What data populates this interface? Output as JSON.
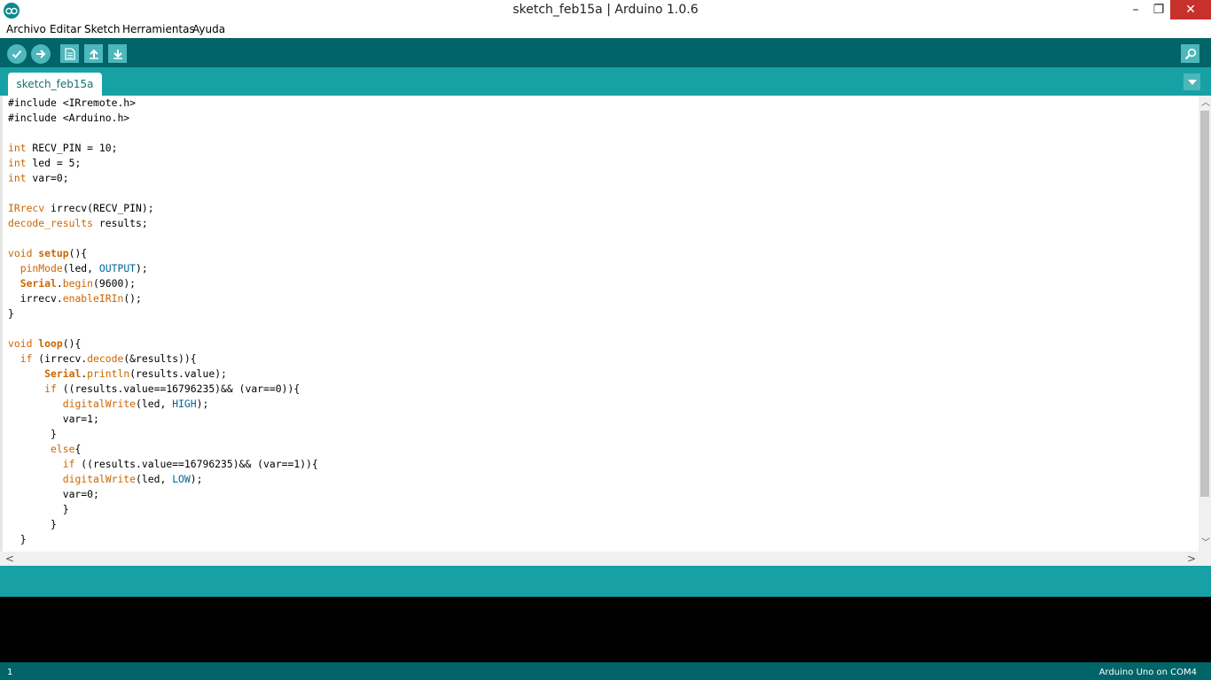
{
  "window": {
    "title": "sketch_feb15a | Arduino 1.0.6",
    "minimize": "–",
    "maximize": "❐",
    "close": "✕"
  },
  "menu": [
    "Archivo",
    "Editar",
    "Sketch",
    "Herramientas",
    "Ayuda"
  ],
  "toolbar": {
    "buttons": [
      "verify-icon",
      "upload-icon",
      "new-icon",
      "open-icon",
      "save-icon",
      "serial-monitor-icon"
    ]
  },
  "tab": {
    "label": "sketch_feb15a"
  },
  "code": {
    "lines": [
      [
        [
          "#include <IRremote.h>",
          "plain"
        ]
      ],
      [
        [
          "#include <Arduino.h>",
          "plain"
        ]
      ],
      [],
      [
        [
          "int",
          "type"
        ],
        [
          " RECV_PIN = 10;",
          "plain"
        ]
      ],
      [
        [
          "int",
          "type"
        ],
        [
          " led = 5;",
          "plain"
        ]
      ],
      [
        [
          "int",
          "type"
        ],
        [
          " var=0;",
          "plain"
        ]
      ],
      [],
      [
        [
          "IRrecv",
          "type"
        ],
        [
          " irrecv(RECV_PIN);",
          "plain"
        ]
      ],
      [
        [
          "decode_results",
          "type"
        ],
        [
          " results;",
          "plain"
        ]
      ],
      [],
      [
        [
          "void",
          "type"
        ],
        [
          " ",
          "plain"
        ],
        [
          "setup",
          "func-bold"
        ],
        [
          "(){",
          "plain"
        ]
      ],
      [
        [
          "  ",
          "plain"
        ],
        [
          "pinMode",
          "func"
        ],
        [
          "(led, ",
          "plain"
        ],
        [
          "OUTPUT",
          "const"
        ],
        [
          ");",
          "plain"
        ]
      ],
      [
        [
          "  ",
          "plain"
        ],
        [
          "Serial",
          "func-bold"
        ],
        [
          ".",
          "plain"
        ],
        [
          "begin",
          "func"
        ],
        [
          "(9600);",
          "plain"
        ]
      ],
      [
        [
          "  irrecv.",
          "plain"
        ],
        [
          "enableIRIn",
          "func"
        ],
        [
          "();",
          "plain"
        ]
      ],
      [
        [
          "}",
          "plain"
        ]
      ],
      [],
      [
        [
          "void",
          "type"
        ],
        [
          " ",
          "plain"
        ],
        [
          "loop",
          "func-bold"
        ],
        [
          "(){",
          "plain"
        ]
      ],
      [
        [
          "  ",
          "plain"
        ],
        [
          "if",
          "type"
        ],
        [
          " (irrecv.",
          "plain"
        ],
        [
          "decode",
          "func"
        ],
        [
          "(&results)){",
          "plain"
        ]
      ],
      [
        [
          "      ",
          "plain"
        ],
        [
          "Serial",
          "func-bold"
        ],
        [
          ".",
          "plain"
        ],
        [
          "println",
          "func"
        ],
        [
          "(results.value);",
          "plain"
        ]
      ],
      [
        [
          "      ",
          "plain"
        ],
        [
          "if",
          "type"
        ],
        [
          " ((results.value==16796235)&& (var==0)){",
          "plain"
        ]
      ],
      [
        [
          "         ",
          "plain"
        ],
        [
          "digitalWrite",
          "func"
        ],
        [
          "(led, ",
          "plain"
        ],
        [
          "HIGH",
          "const"
        ],
        [
          ");",
          "plain"
        ]
      ],
      [
        [
          "         var=1;",
          "plain"
        ]
      ],
      [
        [
          "       }",
          "plain"
        ]
      ],
      [
        [
          "       ",
          "plain"
        ],
        [
          "else",
          "type"
        ],
        [
          "{",
          "plain"
        ]
      ],
      [
        [
          "         ",
          "plain"
        ],
        [
          "if",
          "type"
        ],
        [
          " ((results.value==16796235)&& (var==1)){",
          "plain"
        ]
      ],
      [
        [
          "         ",
          "plain"
        ],
        [
          "digitalWrite",
          "func"
        ],
        [
          "(led, ",
          "plain"
        ],
        [
          "LOW",
          "const"
        ],
        [
          ");",
          "plain"
        ]
      ],
      [
        [
          "         var=0;",
          "plain"
        ]
      ],
      [
        [
          "         }",
          "plain"
        ]
      ],
      [
        [
          "       }",
          "plain"
        ]
      ],
      [
        [
          "  }",
          "plain"
        ]
      ]
    ]
  },
  "colors": {
    "type": "#cc6600",
    "func": "#cc6600",
    "const": "#006699",
    "plain": "#000000"
  },
  "status": {
    "line_number": "1",
    "board": "Arduino Uno on COM4"
  }
}
